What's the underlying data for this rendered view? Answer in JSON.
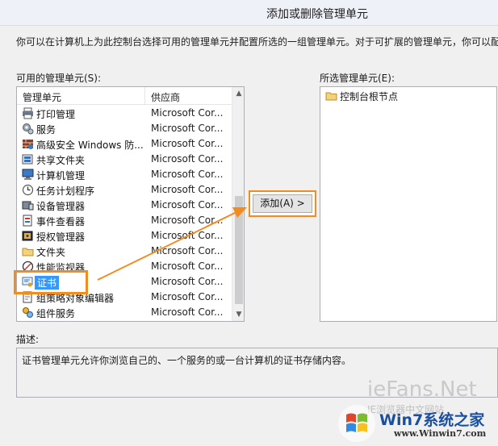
{
  "window": {
    "title": "添加或删除管理单元"
  },
  "intro": "你可以在计算机上为此控制台选择可用的管理单元并配置所选的一组管理单元。对于可扩展的管理单元，你可以配",
  "available": {
    "label": "可用的管理单元(S):",
    "columns": {
      "name": "管理单元",
      "vendor": "供应商"
    },
    "items": [
      {
        "name": "打印管理",
        "vendor": "Microsoft Cor...",
        "icon": "printer-icon"
      },
      {
        "name": "服务",
        "vendor": "Microsoft Cor...",
        "icon": "gear-icon"
      },
      {
        "name": "高级安全 Windows 防...",
        "vendor": "Microsoft Cor...",
        "icon": "firewall-icon"
      },
      {
        "name": "共享文件夹",
        "vendor": "Microsoft Cor...",
        "icon": "shared-folder-icon"
      },
      {
        "name": "计算机管理",
        "vendor": "Microsoft Cor...",
        "icon": "computer-icon"
      },
      {
        "name": "任务计划程序",
        "vendor": "Microsoft Cor...",
        "icon": "clock-icon"
      },
      {
        "name": "设备管理器",
        "vendor": "Microsoft Cor...",
        "icon": "device-icon"
      },
      {
        "name": "事件查看器",
        "vendor": "Microsoft Cor...",
        "icon": "event-log-icon"
      },
      {
        "name": "授权管理器",
        "vendor": "Microsoft Cor...",
        "icon": "authorization-icon"
      },
      {
        "name": "文件夹",
        "vendor": "Microsoft Cor...",
        "icon": "folder-icon"
      },
      {
        "name": "性能监视器",
        "vendor": "Microsoft Cor...",
        "icon": "performance-icon"
      },
      {
        "name": "证书",
        "vendor": "Microsoft Cor...",
        "icon": "certificate-icon",
        "selected": true
      },
      {
        "name": "组策略对象编辑器",
        "vendor": "Microsoft Cor...",
        "icon": "policy-icon"
      },
      {
        "name": "组件服务",
        "vendor": "Microsoft Cor...",
        "icon": "component-icon"
      }
    ]
  },
  "add_button": {
    "label": "添加(A) >"
  },
  "selected": {
    "label": "所选管理单元(E):",
    "root": "控制台根节点"
  },
  "description": {
    "label": "描述:",
    "text": "证书管理单元允许你浏览自己的、一个服务的或一台计算机的证书存储内容。"
  },
  "watermark": {
    "iefans": "ieFans.Net",
    "iefans_cn": "IE浏览器中文网站",
    "brand": "Win7系统之家",
    "url": "www.Winwin7.com"
  },
  "colors": {
    "accent": "#f28c1e",
    "selection": "#3399ff"
  }
}
